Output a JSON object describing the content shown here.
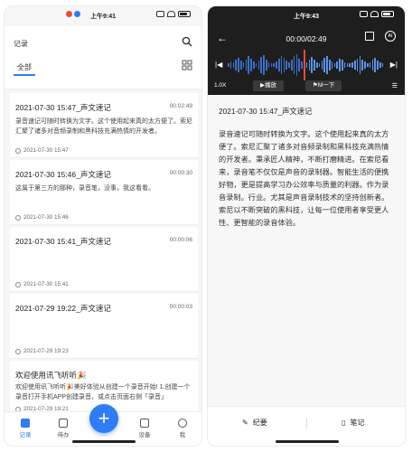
{
  "status": {
    "time": "上午9:41",
    "time_right": "上午9:43"
  },
  "list": {
    "header_title": "记录",
    "tab_all": "全部",
    "items": [
      {
        "title": "2021-07-30 15:47_声文速记",
        "duration": "00:02:49",
        "body": "录音速记可随时转换为文字。这个使用起来真的太方便了。索尼汇聚了诸多对音频录制和黑科技充满热情的开发者。",
        "date": "2021-07-30 15:47"
      },
      {
        "title": "2021-07-30 15:46_声文速记",
        "duration": "00:00:30",
        "body": "这属于第三方的那种，录音笔，没事，我这看看。",
        "date": "2021-07-30 15:46"
      },
      {
        "title": "2021-07-30 15:41_声文速记",
        "duration": "00:00:06",
        "body": "",
        "date": "2021-07-30 15:41"
      },
      {
        "title": "2021-07-29 19:22_声文速记",
        "duration": "00:00:03",
        "body": "",
        "date": "2021-07-29 19:23"
      },
      {
        "title": "欢迎使用讯飞听听🎉",
        "duration": "",
        "body": "欢迎使用讯飞听听🎉美好体验从创建一个录音开始! 1.创建一个录音打开手机APP创建录音，或点击页面右侧「录音」",
        "date": "2021-07-29 19:21"
      }
    ],
    "nav": [
      {
        "label": "记录",
        "icon": "records-icon"
      },
      {
        "label": "待办",
        "icon": "todo-icon"
      },
      {
        "label": "设备",
        "icon": "device-icon"
      },
      {
        "label": "我",
        "icon": "profile-icon"
      }
    ],
    "fab": "+"
  },
  "player": {
    "time_display": "00:00/02:49",
    "ai_label": "AI",
    "speed": "1.0X",
    "play_label": "播放",
    "mark_label": "M一下",
    "record_title": "2021-07-30 15:47_声文速记",
    "transcript": "录音速记可随时转换为文字。这个使用起来真的太方便了。索尼汇聚了诸多对音频录制和黑科技充满热情的开发者。秉承匠人精神，不断打磨精进。在索尼看来，录音笔不仅仅是声音的录制器。智能生活的便携好物，更是提高学习办公效率与质量的利器。作为录音录制。行业。尤其是声音录制技术的坚持创新者。索尼以不断突破的黑科技，让每一位使用者享受更人性、更智能的录音体验。",
    "footer_summary": "纪要",
    "footer_notes": "笔记"
  },
  "colors": {
    "accent": "#2f7cf6",
    "playhead": "#e84a3c",
    "player_bg": "#1e1e1e"
  }
}
